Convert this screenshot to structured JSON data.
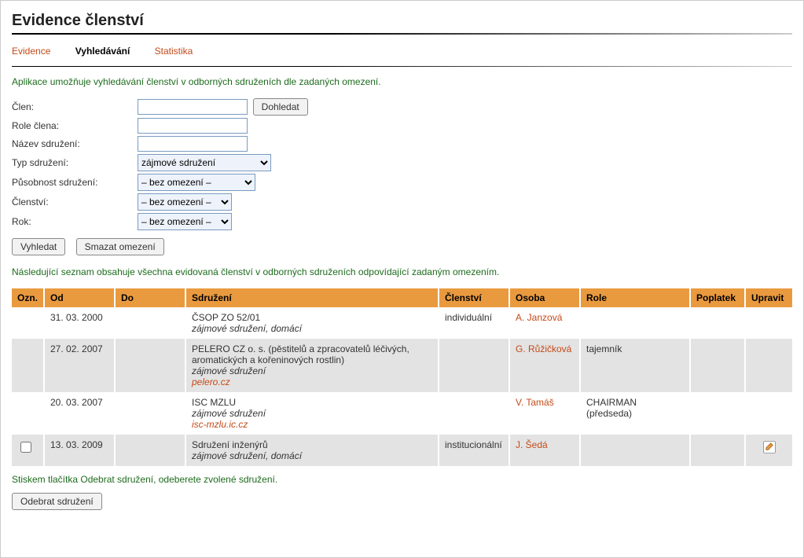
{
  "page_title": "Evidence členství",
  "tabs": [
    {
      "label": "Evidence",
      "active": false
    },
    {
      "label": "Vyhledávání",
      "active": true
    },
    {
      "label": "Statistika",
      "active": false
    }
  ],
  "intro_text": "Aplikace umožňuje vyhledávání členství v odborných sdruženích dle zadaných omezení.",
  "form": {
    "clen_label": "Člen:",
    "clen_value": "",
    "dohledat_btn": "Dohledat",
    "role_label": "Role člena:",
    "role_value": "",
    "nazev_label": "Název sdružení:",
    "nazev_value": "",
    "typ_label": "Typ sdružení:",
    "typ_value": "zájmové sdružení",
    "pusobnost_label": "Působnost sdružení:",
    "pusobnost_value": "– bez omezení –",
    "clenstvi_label": "Členství:",
    "clenstvi_value": "– bez omezení –",
    "rok_label": "Rok:",
    "rok_value": "– bez omezení –",
    "vyhledat_btn": "Vyhledat",
    "smazat_btn": "Smazat omezení"
  },
  "results_text": "Následující seznam obsahuje všechna evidovaná členství v odborných sdruženích odpovídající zadaným omezením.",
  "table": {
    "headers": {
      "ozn": "Ozn.",
      "od": "Od",
      "do": "Do",
      "sdruzeni": "Sdružení",
      "clenstvi": "Členství",
      "osoba": "Osoba",
      "role": "Role",
      "poplatek": "Poplatek",
      "upravit": "Upravit"
    },
    "rows": [
      {
        "checkbox": false,
        "od": "31. 03. 2000",
        "do": "",
        "sdruzeni_name": "ČSOP ZO 52/01",
        "sdruzeni_sub": "zájmové sdružení, domácí",
        "sdruzeni_link": "",
        "clenstvi": "individuální",
        "osoba": "A. Janzová",
        "role": "",
        "poplatek": "",
        "editable": false,
        "alt": false
      },
      {
        "checkbox": false,
        "od": "27. 02. 2007",
        "do": "",
        "sdruzeni_name": "PELERO CZ o. s. (pěstitelů a zpracovatelů léčivých, aromatických a kořeninových rostlin)",
        "sdruzeni_sub": "zájmové sdružení",
        "sdruzeni_link": "pelero.cz",
        "clenstvi": "",
        "osoba": "G. Růžičková",
        "role": "tajemník",
        "poplatek": "",
        "editable": false,
        "alt": true
      },
      {
        "checkbox": false,
        "od": "20. 03. 2007",
        "do": "",
        "sdruzeni_name": "ISC MZLU",
        "sdruzeni_sub": "zájmové sdružení",
        "sdruzeni_link": "isc-mzlu.ic.cz",
        "clenstvi": "",
        "osoba": "V. Tamáš",
        "role": "CHAIRMAN (předseda)",
        "poplatek": "",
        "editable": false,
        "alt": false
      },
      {
        "checkbox": true,
        "od": "13. 03. 2009",
        "do": "",
        "sdruzeni_name": "Sdružení inženýrů",
        "sdruzeni_sub": "zájmové sdružení, domácí",
        "sdruzeni_link": "",
        "clenstvi": "institucionální",
        "osoba": "J. Šedá",
        "role": "",
        "poplatek": "",
        "editable": true,
        "alt": true
      }
    ]
  },
  "remove_note": "Stiskem tlačítka Odebrat sdružení, odeberete zvolené sdružení.",
  "remove_btn": "Odebrat sdružení"
}
